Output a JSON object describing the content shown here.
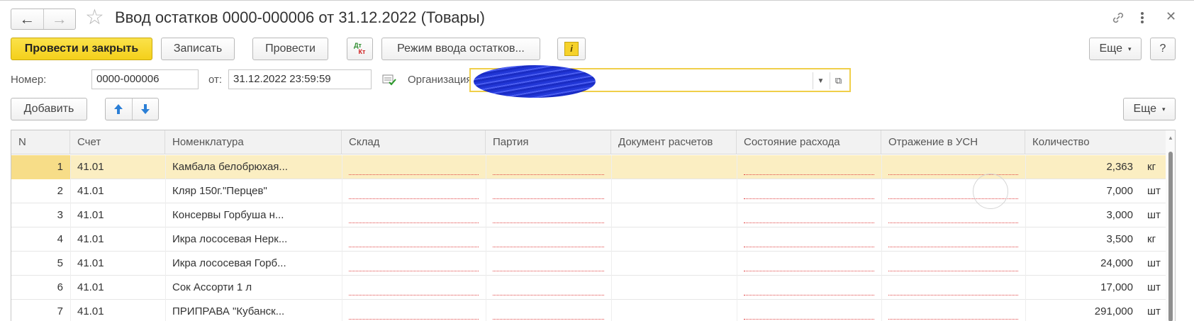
{
  "window": {
    "title": "Ввод остатков 0000-000006 от 31.12.2022 (Товары)"
  },
  "toolbar": {
    "post_and_close": "Провести и закрыть",
    "save": "Записать",
    "post": "Провести",
    "dtkt_top": "Дт",
    "dtkt_bottom": "Кт",
    "mode": "Режим ввода остатков...",
    "info_glyph": "i",
    "more": "Еще",
    "help": "?"
  },
  "header": {
    "number_label": "Номер:",
    "number_value": "0000-000006",
    "date_label": "от:",
    "date_value": "31.12.2022 23:59:59",
    "org_label": "Организация:",
    "org_value": ""
  },
  "table_toolbar": {
    "add": "Добавить",
    "more": "Еще"
  },
  "table": {
    "columns": [
      "N",
      "Счет",
      "Номенклатура",
      "Склад",
      "Партия",
      "Документ расчетов",
      "Состояние расхода",
      "Отражение в УСН",
      "Количество"
    ],
    "rows": [
      {
        "n": "1",
        "account": "41.01",
        "item": "Камбала белобрюхая...",
        "qty": "2,363",
        "unit": "кг"
      },
      {
        "n": "2",
        "account": "41.01",
        "item": "Кляр 150г.\"Перцев\"",
        "qty": "7,000",
        "unit": "шт"
      },
      {
        "n": "3",
        "account": "41.01",
        "item": "Консервы Горбуша н...",
        "qty": "3,000",
        "unit": "шт"
      },
      {
        "n": "4",
        "account": "41.01",
        "item": "Икра лососевая Нерк...",
        "qty": "3,500",
        "unit": "кг"
      },
      {
        "n": "5",
        "account": "41.01",
        "item": "Икра лососевая Горб...",
        "qty": "24,000",
        "unit": "шт"
      },
      {
        "n": "6",
        "account": "41.01",
        "item": "Сок Ассорти 1 л",
        "qty": "17,000",
        "unit": "шт"
      },
      {
        "n": "7",
        "account": "41.01",
        "item": "ПРИПРАВА \"Кубанск...",
        "qty": "291,000",
        "unit": "шт"
      }
    ]
  },
  "colors": {
    "primary": "#f4d01b",
    "selected_row": "#fbeec2",
    "required_underline": "#e04040",
    "redaction": "#2136d6"
  }
}
